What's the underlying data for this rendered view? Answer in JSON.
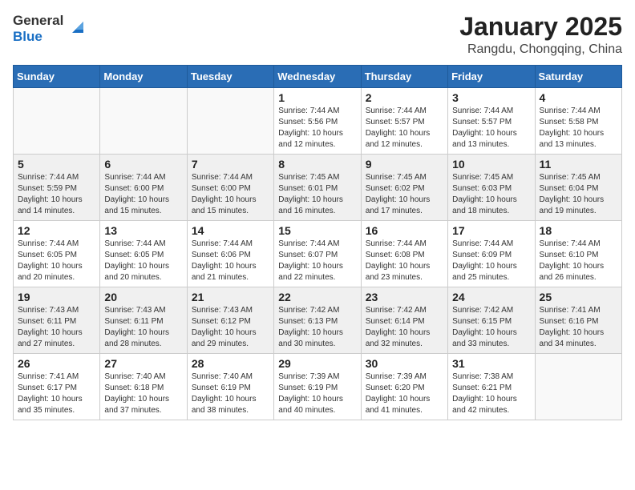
{
  "header": {
    "logo_general": "General",
    "logo_blue": "Blue",
    "title": "January 2025",
    "subtitle": "Rangdu, Chongqing, China"
  },
  "weekdays": [
    "Sunday",
    "Monday",
    "Tuesday",
    "Wednesday",
    "Thursday",
    "Friday",
    "Saturday"
  ],
  "weeks": [
    [
      {
        "day": "",
        "info": ""
      },
      {
        "day": "",
        "info": ""
      },
      {
        "day": "",
        "info": ""
      },
      {
        "day": "1",
        "info": "Sunrise: 7:44 AM\nSunset: 5:56 PM\nDaylight: 10 hours\nand 12 minutes."
      },
      {
        "day": "2",
        "info": "Sunrise: 7:44 AM\nSunset: 5:57 PM\nDaylight: 10 hours\nand 12 minutes."
      },
      {
        "day": "3",
        "info": "Sunrise: 7:44 AM\nSunset: 5:57 PM\nDaylight: 10 hours\nand 13 minutes."
      },
      {
        "day": "4",
        "info": "Sunrise: 7:44 AM\nSunset: 5:58 PM\nDaylight: 10 hours\nand 13 minutes."
      }
    ],
    [
      {
        "day": "5",
        "info": "Sunrise: 7:44 AM\nSunset: 5:59 PM\nDaylight: 10 hours\nand 14 minutes."
      },
      {
        "day": "6",
        "info": "Sunrise: 7:44 AM\nSunset: 6:00 PM\nDaylight: 10 hours\nand 15 minutes."
      },
      {
        "day": "7",
        "info": "Sunrise: 7:44 AM\nSunset: 6:00 PM\nDaylight: 10 hours\nand 15 minutes."
      },
      {
        "day": "8",
        "info": "Sunrise: 7:45 AM\nSunset: 6:01 PM\nDaylight: 10 hours\nand 16 minutes."
      },
      {
        "day": "9",
        "info": "Sunrise: 7:45 AM\nSunset: 6:02 PM\nDaylight: 10 hours\nand 17 minutes."
      },
      {
        "day": "10",
        "info": "Sunrise: 7:45 AM\nSunset: 6:03 PM\nDaylight: 10 hours\nand 18 minutes."
      },
      {
        "day": "11",
        "info": "Sunrise: 7:45 AM\nSunset: 6:04 PM\nDaylight: 10 hours\nand 19 minutes."
      }
    ],
    [
      {
        "day": "12",
        "info": "Sunrise: 7:44 AM\nSunset: 6:05 PM\nDaylight: 10 hours\nand 20 minutes."
      },
      {
        "day": "13",
        "info": "Sunrise: 7:44 AM\nSunset: 6:05 PM\nDaylight: 10 hours\nand 20 minutes."
      },
      {
        "day": "14",
        "info": "Sunrise: 7:44 AM\nSunset: 6:06 PM\nDaylight: 10 hours\nand 21 minutes."
      },
      {
        "day": "15",
        "info": "Sunrise: 7:44 AM\nSunset: 6:07 PM\nDaylight: 10 hours\nand 22 minutes."
      },
      {
        "day": "16",
        "info": "Sunrise: 7:44 AM\nSunset: 6:08 PM\nDaylight: 10 hours\nand 23 minutes."
      },
      {
        "day": "17",
        "info": "Sunrise: 7:44 AM\nSunset: 6:09 PM\nDaylight: 10 hours\nand 25 minutes."
      },
      {
        "day": "18",
        "info": "Sunrise: 7:44 AM\nSunset: 6:10 PM\nDaylight: 10 hours\nand 26 minutes."
      }
    ],
    [
      {
        "day": "19",
        "info": "Sunrise: 7:43 AM\nSunset: 6:11 PM\nDaylight: 10 hours\nand 27 minutes."
      },
      {
        "day": "20",
        "info": "Sunrise: 7:43 AM\nSunset: 6:11 PM\nDaylight: 10 hours\nand 28 minutes."
      },
      {
        "day": "21",
        "info": "Sunrise: 7:43 AM\nSunset: 6:12 PM\nDaylight: 10 hours\nand 29 minutes."
      },
      {
        "day": "22",
        "info": "Sunrise: 7:42 AM\nSunset: 6:13 PM\nDaylight: 10 hours\nand 30 minutes."
      },
      {
        "day": "23",
        "info": "Sunrise: 7:42 AM\nSunset: 6:14 PM\nDaylight: 10 hours\nand 32 minutes."
      },
      {
        "day": "24",
        "info": "Sunrise: 7:42 AM\nSunset: 6:15 PM\nDaylight: 10 hours\nand 33 minutes."
      },
      {
        "day": "25",
        "info": "Sunrise: 7:41 AM\nSunset: 6:16 PM\nDaylight: 10 hours\nand 34 minutes."
      }
    ],
    [
      {
        "day": "26",
        "info": "Sunrise: 7:41 AM\nSunset: 6:17 PM\nDaylight: 10 hours\nand 35 minutes."
      },
      {
        "day": "27",
        "info": "Sunrise: 7:40 AM\nSunset: 6:18 PM\nDaylight: 10 hours\nand 37 minutes."
      },
      {
        "day": "28",
        "info": "Sunrise: 7:40 AM\nSunset: 6:19 PM\nDaylight: 10 hours\nand 38 minutes."
      },
      {
        "day": "29",
        "info": "Sunrise: 7:39 AM\nSunset: 6:19 PM\nDaylight: 10 hours\nand 40 minutes."
      },
      {
        "day": "30",
        "info": "Sunrise: 7:39 AM\nSunset: 6:20 PM\nDaylight: 10 hours\nand 41 minutes."
      },
      {
        "day": "31",
        "info": "Sunrise: 7:38 AM\nSunset: 6:21 PM\nDaylight: 10 hours\nand 42 minutes."
      },
      {
        "day": "",
        "info": ""
      }
    ]
  ]
}
